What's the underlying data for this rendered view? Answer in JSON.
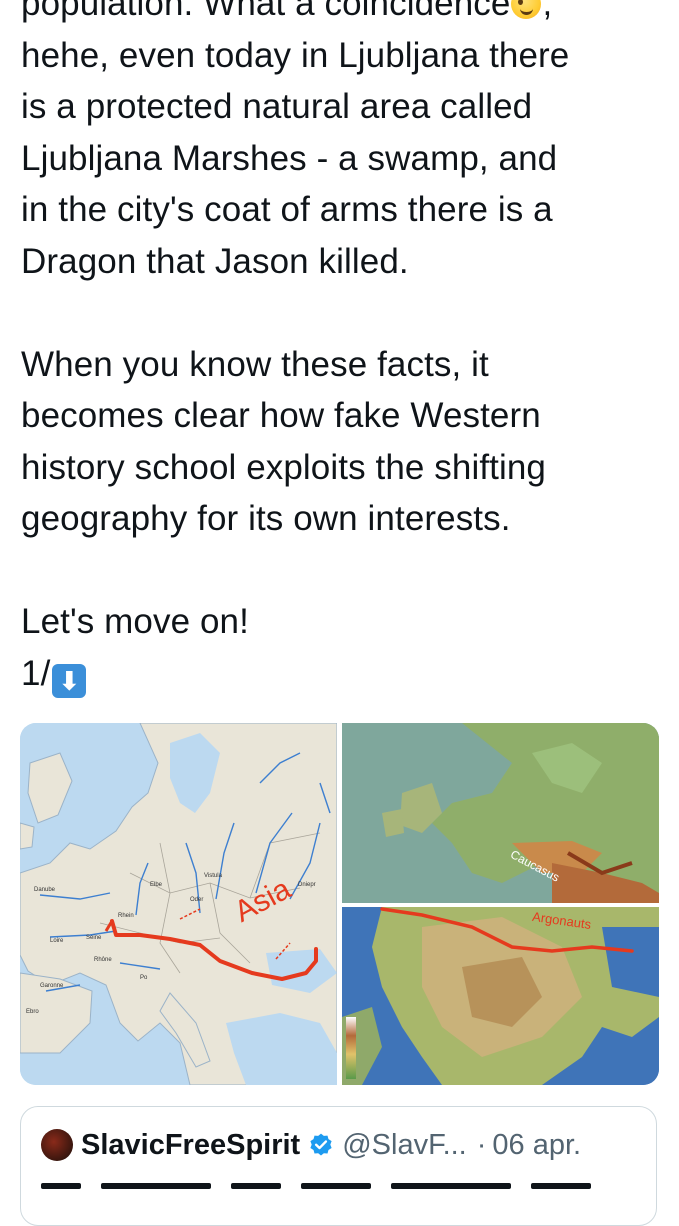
{
  "tweet": {
    "lines": [
      "population. What a coincidence",
      "hehe, even today in Ljubljana there",
      "is a protected natural area called",
      "Ljubljana Marshes - a swamp, and",
      "in the city's coat of arms there is a",
      "Dragon that Jason killed.",
      "When you know these facts, it",
      "becomes clear how fake Western",
      "history school exploits the shifting",
      "geography for its own interests.",
      "Let's move on!",
      "1/"
    ],
    "line1_suffix": ",",
    "emoji_icon": "winking-face-emoji",
    "arrow_icon": "down-arrow-emoji",
    "arrow_glyph": "⬇"
  },
  "media": {
    "europe_map": {
      "labels": [
        "Asia",
        "Danube",
        "Loire",
        "Seine",
        "Rhein",
        "Elbe",
        "Oder",
        "Vistula",
        "Dniepr",
        "Garonne",
        "Rhône",
        "Po",
        "Ebro"
      ]
    },
    "relief_map_top": {
      "label": "Caucasus"
    },
    "relief_map_bottom": {
      "label": "Argonauts"
    }
  },
  "quote": {
    "name": "SlavicFreeSpirit",
    "handle": "@SlavF...",
    "dot": "·",
    "date": "06 apr.",
    "verified_color": "#1d9bf0"
  }
}
